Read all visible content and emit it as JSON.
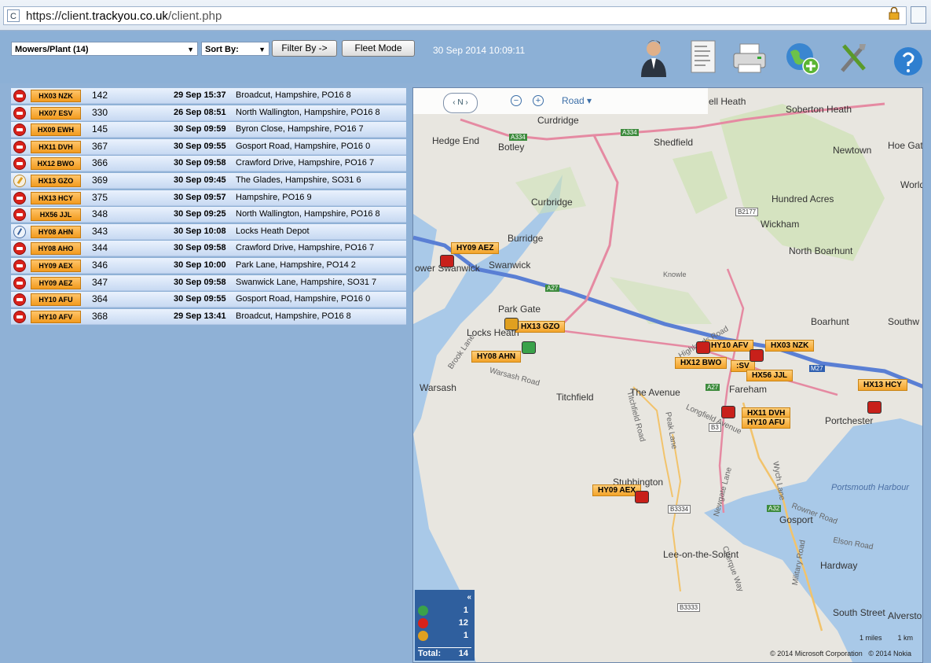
{
  "browser": {
    "url_prefix": "https://client.",
    "url_domain": "trackyou.co.uk",
    "url_path": "/client.php"
  },
  "toolbar": {
    "group_select": "Mowers/Plant (14)",
    "sort_label": "Sort By:",
    "filter_button": "Filter By ->",
    "fleet_button": "Fleet Mode",
    "datetime": "30 Sep 2014 10:09:11",
    "icons": [
      "user-icon",
      "report-icon",
      "printer-icon",
      "add-globe-icon",
      "tools-icon",
      "help-icon"
    ]
  },
  "vehicles": [
    {
      "status": "stopped",
      "reg": "HX03 NZK",
      "num": "142",
      "date": "29 Sep 15:37",
      "loc": "Broadcut, Hampshire, PO16 8"
    },
    {
      "status": "stopped",
      "reg": "HX07 ESV",
      "num": "330",
      "date": "26 Sep 08:51",
      "loc": "North Wallington, Hampshire, PO16 8"
    },
    {
      "status": "stopped",
      "reg": "HX09 EWH",
      "num": "145",
      "date": "30 Sep 09:59",
      "loc": "Byron Close, Hampshire, PO16 7"
    },
    {
      "status": "stopped",
      "reg": "HX11 DVH",
      "num": "367",
      "date": "30 Sep 09:55",
      "loc": "Gosport Road, Hampshire, PO16 0"
    },
    {
      "status": "stopped",
      "reg": "HX12 BWO",
      "num": "366",
      "date": "30 Sep 09:58",
      "loc": "Crawford Drive, Hampshire, PO16 7"
    },
    {
      "status": "idle",
      "reg": "HX13 GZO",
      "num": "369",
      "date": "30 Sep 09:45",
      "loc": "The Glades, Hampshire, SO31 6"
    },
    {
      "status": "stopped",
      "reg": "HX13 HCY",
      "num": "375",
      "date": "30 Sep 09:57",
      "loc": "Hampshire, PO16 9"
    },
    {
      "status": "stopped",
      "reg": "HX56 JJL",
      "num": "348",
      "date": "30 Sep 09:25",
      "loc": "North Wallington, Hampshire, PO16 8"
    },
    {
      "status": "moving",
      "reg": "HY08 AHN",
      "num": "343",
      "date": "30 Sep 10:08",
      "loc": "Locks Heath Depot"
    },
    {
      "status": "stopped",
      "reg": "HY08 AHO",
      "num": "344",
      "date": "30 Sep 09:58",
      "loc": "Crawford Drive, Hampshire, PO16 7"
    },
    {
      "status": "stopped",
      "reg": "HY09 AEX",
      "num": "346",
      "date": "30 Sep 10:00",
      "loc": "Park Lane, Hampshire, PO14 2"
    },
    {
      "status": "stopped",
      "reg": "HY09 AEZ",
      "num": "347",
      "date": "30 Sep 09:58",
      "loc": "Swanwick Lane, Hampshire, SO31 7"
    },
    {
      "status": "stopped",
      "reg": "HY10 AFU",
      "num": "364",
      "date": "30 Sep 09:55",
      "loc": "Gosport Road, Hampshire, PO16 0"
    },
    {
      "status": "stopped",
      "reg": "HY10 AFV",
      "num": "368",
      "date": "29 Sep 13:41",
      "loc": "Broadcut, Hampshire, PO16 8"
    }
  ],
  "map": {
    "compass": "N",
    "road_label": "Road",
    "places": [
      "ell Heath",
      "Soberton Heath",
      "Curdridge",
      "Hedge End",
      "Botley",
      "Shedfield",
      "Newtown",
      "Hoe Gat",
      "World",
      "Curbridge",
      "Hundred Acres",
      "Wickham",
      "Burridge",
      "North Boarhunt",
      "Swanwick",
      "ower Swanwick",
      "Knowle",
      "Park Gate",
      "Locks Heath",
      "Boarhunt",
      "Southw",
      "Warsash",
      "Titchfield",
      "The Avenue",
      "Fareham",
      "Portchester",
      "Stubbington",
      "Portsmouth Harbour",
      "Gosport",
      "Lee-on-the-Solent",
      "Hardway",
      "South Street",
      "Alverstoke",
      "Brook Lane",
      "Highlands Road",
      "Warsash Road",
      "Titchfield Road",
      "Peak Lane",
      "Longfield Avenue",
      "Newgate Lane",
      "Wych Lane",
      "Rowner Road",
      "Cherque Way",
      "Military Road",
      "Elson Road"
    ],
    "roads": [
      "A334",
      "A334",
      "B2177",
      "A27",
      "A27",
      "M27",
      "B3334",
      "B3333",
      "A32",
      "B3"
    ],
    "tags": [
      "HY09 AEZ",
      "HX13 GZO",
      "HY08 AHN",
      "HY10 AFV",
      "HX03 NZK",
      "HX12 BWO",
      ":SV",
      "HX56 JJL",
      "HX13 HCY",
      "HX11 DVH",
      "HY10 AFU",
      "HY09 AEX"
    ],
    "legend": {
      "moving": "1",
      "stopped": "12",
      "idle": "1",
      "total_label": "Total:",
      "total": "14"
    },
    "scale": {
      "miles": "1 miles",
      "km": "1 km"
    },
    "copyright_ms": "© 2014 Microsoft Corporation",
    "copyright_nokia": "© 2014 Nokia"
  }
}
